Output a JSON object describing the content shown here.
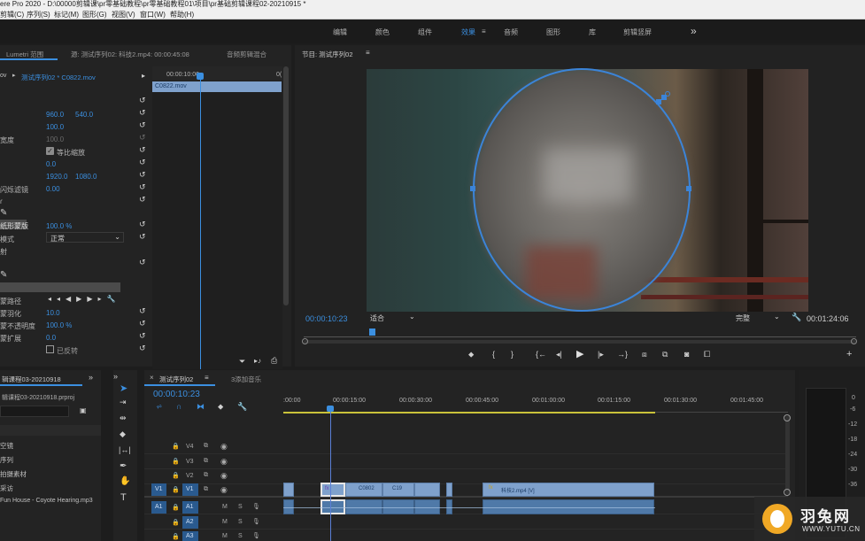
{
  "window_title": "ere Pro 2020 - D:\\00000剪辑课\\pr零基础教程\\pr零基础教程01\\项目\\pr基础剪辑课程02-20210915 *",
  "menu": [
    "剪辑(C)",
    "序列(S)",
    "标记(M)",
    "图形(G)",
    "视图(V)",
    "窗口(W)",
    "帮助(H)"
  ],
  "workspaces": {
    "items": [
      "编辑",
      "颜色",
      "组件",
      "效果",
      "音频",
      "图形",
      "库",
      "剪辑竖屏"
    ],
    "active": "效果",
    "more": "»"
  },
  "effect_controls": {
    "tabs": [
      "Lumetri 范围",
      "源: 测试序列02: 科技2.mp4: 00:00:45:08",
      "音频剪辑混合"
    ],
    "clip_header": "测试序列02 * C0822.mov",
    "timecode": "00:00:10:00",
    "clip_bar": "C0822.mov",
    "pos_x": "960.0",
    "pos_y": "540.0",
    "scale": "100.0",
    "scale_width": "100.0",
    "uniform_scale": "等比缩放",
    "rotation": "0.0",
    "anchor_x": "1920.0",
    "anchor_y": "1080.0",
    "flicker_label": "闪烁滤镜",
    "flicker": "0.00",
    "mask_label": "纸形蒙版",
    "opacity": "100.0 %",
    "blend_label": "模式",
    "blend_mode": "正常",
    "map_label": "射",
    "mask_path_label": "蒙路径",
    "feather_label": "蒙羽化",
    "feather": "10.0",
    "mask_opacity_label": "蒙不透明度",
    "mask_opacity": "100.0 %",
    "expansion_label": "蒙扩展",
    "expansion": "0.0",
    "invert_label": "已反转"
  },
  "program_monitor": {
    "title": "节目: 测试序列02",
    "timecode": "00:00:10:23",
    "fit": "适合",
    "quality": "完整",
    "duration": "00:01:24:06"
  },
  "project": {
    "tab": "辑课程03-20210918",
    "file": "辑课程03-20210918.prproj",
    "items": [
      "空镜",
      "序列",
      "拍摄素材",
      "采访",
      "Fun House - Coyote Hearing.mp3"
    ]
  },
  "timeline": {
    "tabs": [
      "测试序列02",
      "3添加音乐"
    ],
    "timecode": "00:00:10:23",
    "ruler": [
      ":00:00",
      "00:00:15:00",
      "00:00:30:00",
      "00:00:45:00",
      "00:01:00:00",
      "00:01:15:00",
      "00:01:30:00",
      "00:01:45:00"
    ],
    "video_tracks": [
      "V4",
      "V3",
      "V2",
      "V1"
    ],
    "audio_tracks": [
      "A1",
      "A2",
      "A3"
    ],
    "src_v": "V1",
    "src_a": "A1",
    "clips": {
      "c1": "C0802",
      "c2": "C19",
      "c3": "科技2.mp4 [V]"
    }
  },
  "meter": [
    "0",
    "-6",
    "-12",
    "-18",
    "-24",
    "-30",
    "-36"
  ],
  "watermark": {
    "name": "羽兔网",
    "url": "WWW.YUTU.CN"
  }
}
